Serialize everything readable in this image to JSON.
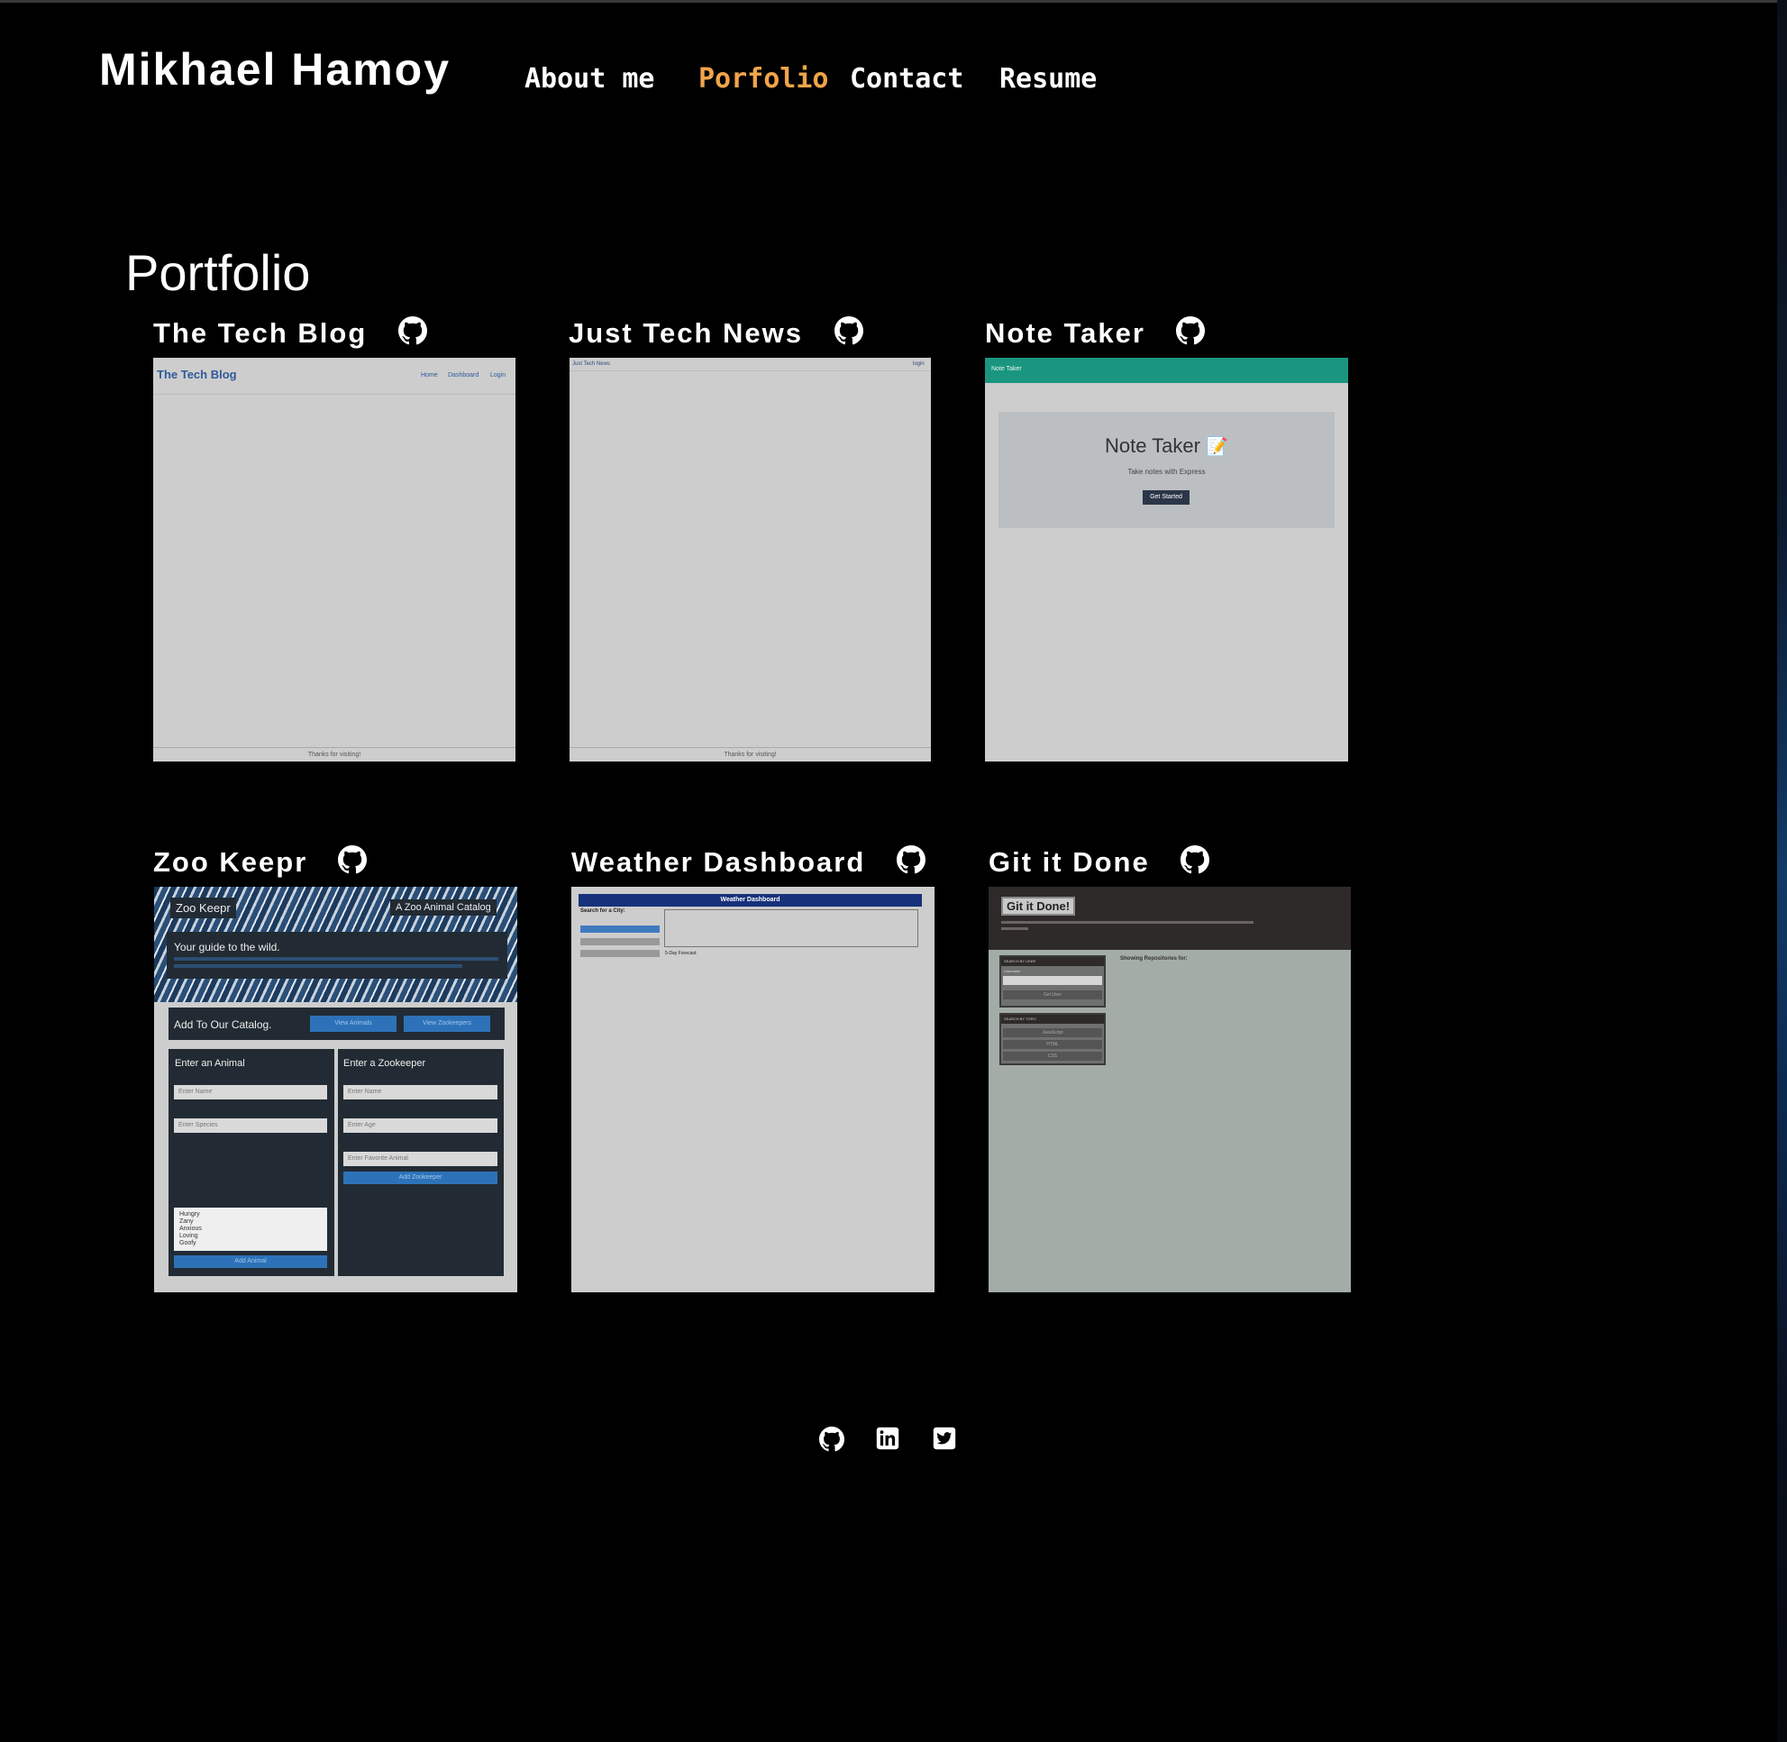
{
  "header": {
    "brand": "Mikhael Hamoy",
    "nav": [
      {
        "label": "About me",
        "active": false
      },
      {
        "label": "Porfolio",
        "active": true
      },
      {
        "label": "Contact",
        "active": false
      },
      {
        "label": "Resume",
        "active": false
      }
    ]
  },
  "section_title": "Portfolio",
  "projects": [
    {
      "title": "The Tech Blog",
      "icon": "github-icon",
      "preview": {
        "brand": "The Tech Blog",
        "nav": [
          "Home",
          "Dashboard",
          "Login"
        ],
        "footer": "Thanks for visiting!"
      }
    },
    {
      "title": "Just Tech News",
      "icon": "github-icon",
      "preview": {
        "brand": "Just Tech News",
        "nav": [
          "login"
        ],
        "footer": "Thanks for visiting!"
      }
    },
    {
      "title": "Note Taker",
      "icon": "github-icon",
      "preview": {
        "bar": "Note Taker",
        "heading": "Note Taker",
        "sub": "Take notes with Express",
        "button": "Get Started"
      }
    },
    {
      "title": "Zoo Keepr",
      "icon": "github-icon",
      "preview": {
        "brand": "Zoo Keepr",
        "tagline": "A Zoo Animal Catalog",
        "hero": "Your guide to the wild.",
        "catalog": "Add To Our Catalog.",
        "btn1": "View Animals",
        "btn2": "View Zookeepers",
        "animal_title": "Enter an Animal",
        "animal_name": "Enter Name",
        "species": "Enter Species",
        "traits": [
          "Hungry",
          "Zany",
          "Anxious",
          "Loving",
          "Goofy"
        ],
        "add_animal": "Add Animal",
        "keeper_title": "Enter a Zookeeper",
        "keeper_name": "Enter Name",
        "age": "Enter Age",
        "fav": "Enter Favorite Animal",
        "add_keeper": "Add Zookeeper"
      }
    },
    {
      "title": "Weather Dashboard",
      "icon": "github-icon",
      "preview": {
        "bar": "Weather Dashboard",
        "search": "Search for a City:",
        "forecast": "5-Day Forecast:"
      }
    },
    {
      "title": "Git it Done",
      "icon": "github-icon",
      "preview": {
        "brand": "Git it Done!",
        "s1": "SEARCH BY USER",
        "s1_field": "Username",
        "s1_btn": "Get User",
        "s2": "SEARCH BY TOPIC",
        "topics": [
          "JavaScript",
          "HTML",
          "CSS"
        ],
        "showing": "Showing Repositories for:"
      }
    }
  ],
  "footer": {
    "icons": [
      "github-icon",
      "linkedin-icon",
      "twitter-icon"
    ]
  },
  "colors": {
    "background": "#000000",
    "accent": "#f0a44a",
    "text": "#ffffff",
    "preview_bg": "#cdcdcd"
  }
}
